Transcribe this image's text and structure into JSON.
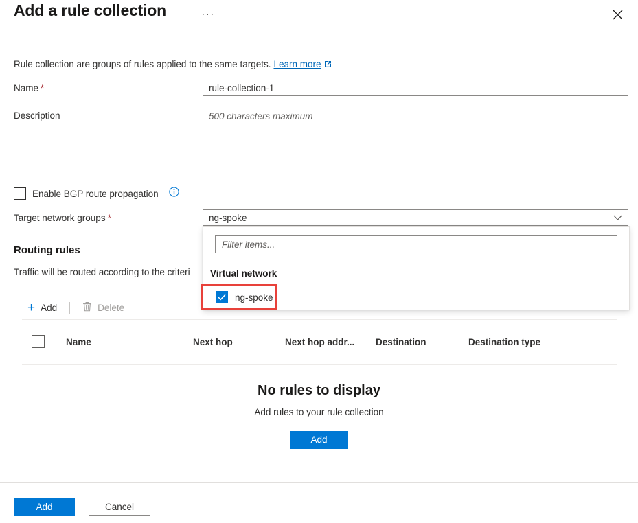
{
  "header": {
    "title": "Add a rule collection",
    "more_label": "···",
    "close_label": "",
    "close_icon": "close-icon"
  },
  "intro": {
    "text": "Rule collection are groups of rules applied to the same targets.",
    "link_label": "Learn more",
    "link_icon": "external-link-icon"
  },
  "form": {
    "name": {
      "label": "Name",
      "required_marker": "*",
      "value": "rule-collection-1"
    },
    "description": {
      "label": "Description",
      "value": "",
      "placeholder": "500 characters maximum"
    },
    "bgp": {
      "label": "Enable BGP route propagation",
      "checked": false,
      "info_icon": "info-icon"
    },
    "target_network_groups": {
      "label": "Target network groups",
      "required_marker": "*",
      "value": "ng-spoke",
      "chevron_icon": "chevron-down-icon"
    }
  },
  "dropdown": {
    "open": true,
    "filter_placeholder": "Filter items...",
    "filter_value": "",
    "group_header": "Virtual network",
    "options": [
      {
        "label": "ng-spoke",
        "checked": true,
        "highlighted": true
      }
    ],
    "highlight_color": "#e8413a"
  },
  "routing_rules": {
    "heading": "Routing rules",
    "subtext": "Traffic will be routed according to the criteri",
    "commands": {
      "add_label": "Add",
      "add_icon": "plus-icon",
      "delete_label": "Delete",
      "delete_icon": "trash-icon",
      "delete_disabled": true
    },
    "table": {
      "columns": [
        "Name",
        "Next hop",
        "Next hop addr...",
        "Destination",
        "Destination type"
      ],
      "rows": []
    },
    "empty_state": {
      "title": "No rules to display",
      "subtitle": "Add rules to your rule collection",
      "button_label": "Add"
    }
  },
  "footer": {
    "primary_label": "Add",
    "secondary_label": "Cancel"
  },
  "colors": {
    "accent": "#0078d4",
    "link": "#0067b8",
    "required": "#a4262c",
    "highlight": "#e8413a"
  }
}
